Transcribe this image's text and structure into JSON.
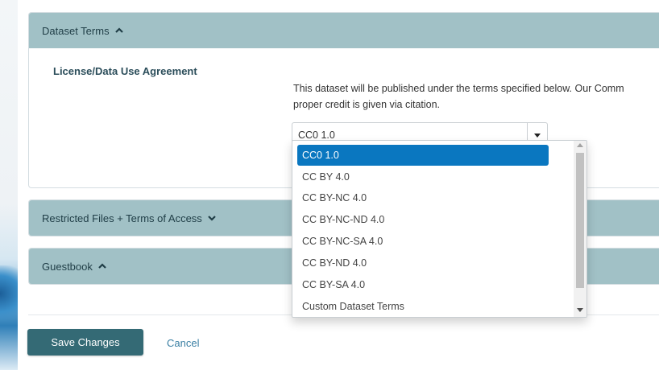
{
  "panels": {
    "dataset_terms": {
      "title": "Dataset Terms",
      "expanded": true
    },
    "restricted": {
      "title": "Restricted Files + Terms of Access",
      "expanded": false
    },
    "guestbook": {
      "title": "Guestbook",
      "expanded": true
    }
  },
  "license": {
    "label": "License/Data Use Agreement",
    "description_line1": "This dataset will be published under the terms specified below. Our Comm",
    "description_line2": "proper credit is given via citation.",
    "selected": "CC0 1.0",
    "options": [
      "CC0 1.0",
      "CC BY 4.0",
      "CC BY-NC 4.0",
      "CC BY-NC-ND 4.0",
      "CC BY-NC-SA 4.0",
      "CC BY-ND 4.0",
      "CC BY-SA 4.0",
      "Custom Dataset Terms"
    ]
  },
  "actions": {
    "save": "Save Changes",
    "cancel": "Cancel"
  },
  "colors": {
    "panel_header": "#a1c1c6",
    "primary_button": "#346a75",
    "selected_option": "#0a77c0",
    "link": "#3a7fa3"
  }
}
